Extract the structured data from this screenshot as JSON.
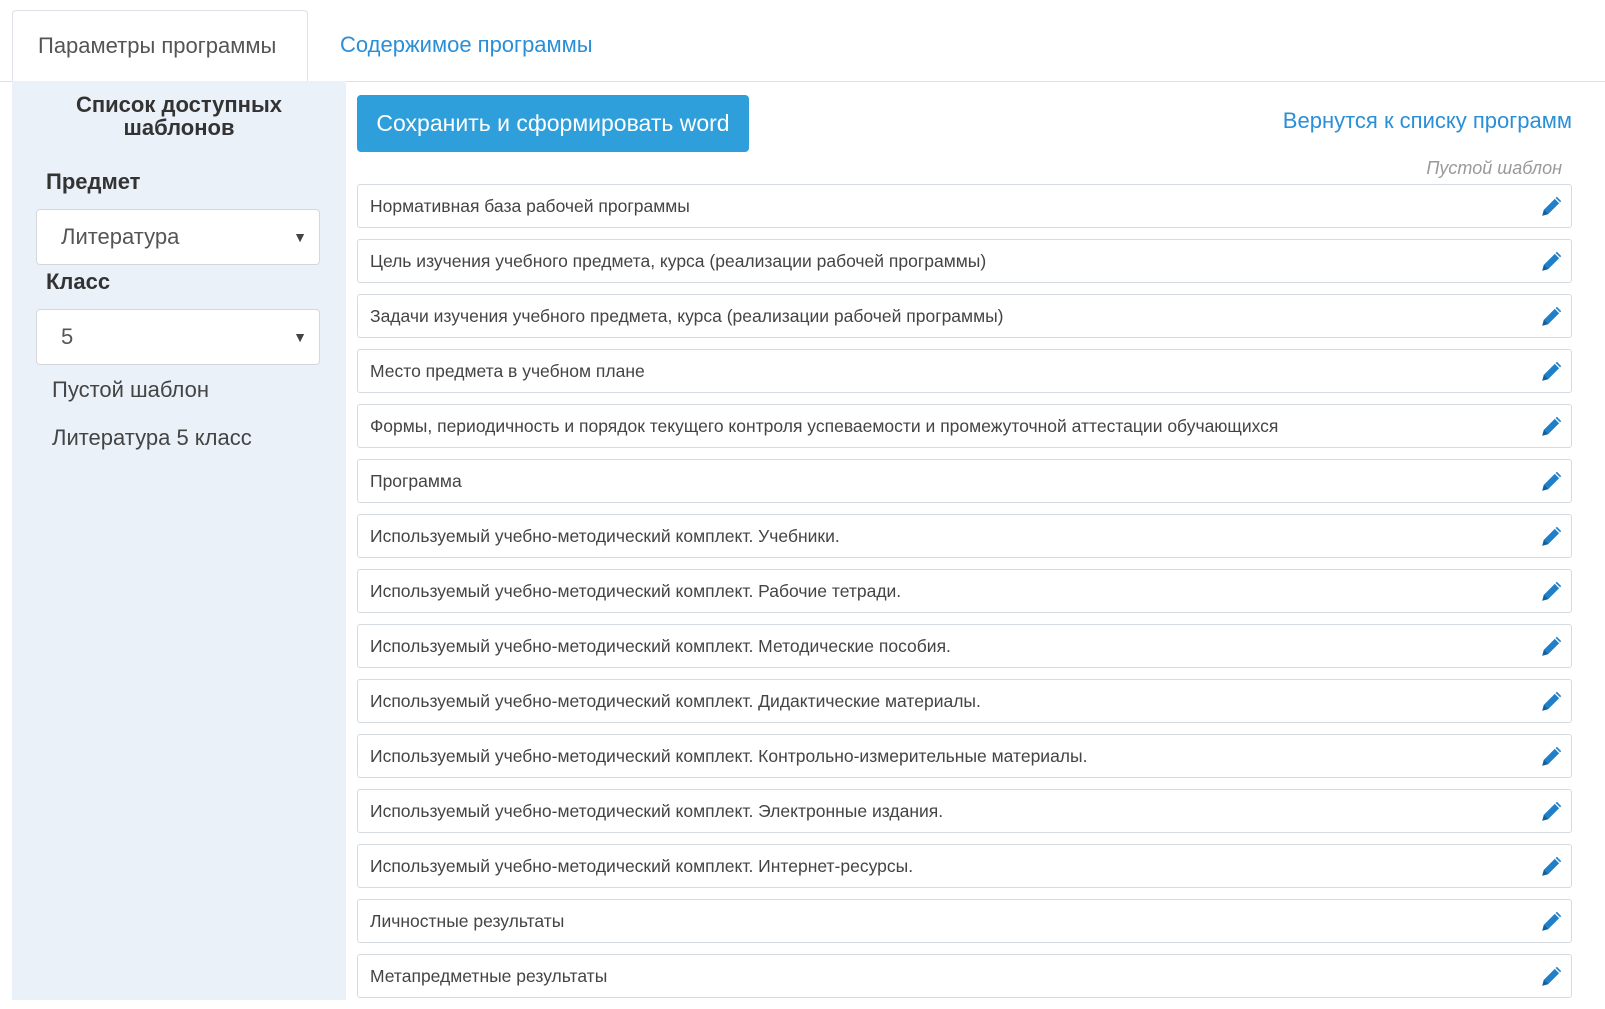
{
  "tabs": {
    "params": "Параметры программы",
    "content": "Содержимое программы"
  },
  "sidebar": {
    "title": "Список доступных шаблонов",
    "subject_label": "Предмет",
    "subject_value": "Литература",
    "class_label": "Класс",
    "class_value": "5",
    "templates": [
      "Пустой шаблон",
      "Литература 5 класс"
    ]
  },
  "toolbar": {
    "save_label": "Сохранить и сформировать word",
    "back_label": "Вернутся к списку программ",
    "current_template": "Пустой шаблон"
  },
  "sections": [
    "Нормативная база рабочей программы",
    "Цель изучения учебного предмета, курса (реализации рабочей программы)",
    "Задачи изучения учебного предмета, курса (реализации рабочей программы)",
    "Место предмета в учебном плане",
    "Формы, периодичность и порядок текущего контроля успеваемости и промежуточной аттестации обучающихся",
    "Программа",
    "Используемый учебно-методический комплект. Учебники.",
    "Используемый учебно-методический комплект. Рабочие тетради.",
    "Используемый учебно-методический комплект. Методические пособия.",
    "Используемый учебно-методический комплект. Дидактические материалы.",
    "Используемый учебно-методический комплект. Контрольно-измерительные материалы.",
    "Используемый учебно-методический комплект. Электронные издания.",
    "Используемый учебно-методический комплект. Интернет-ресурсы.",
    "Личностные результаты",
    "Метапредметные результаты"
  ],
  "icons": {
    "edit": "pencil-icon",
    "dropdown": "caret-down-icon"
  },
  "colors": {
    "accent": "#2f9fdc",
    "link": "#2a8fd6",
    "sidebar_bg": "#eaf1f9"
  }
}
